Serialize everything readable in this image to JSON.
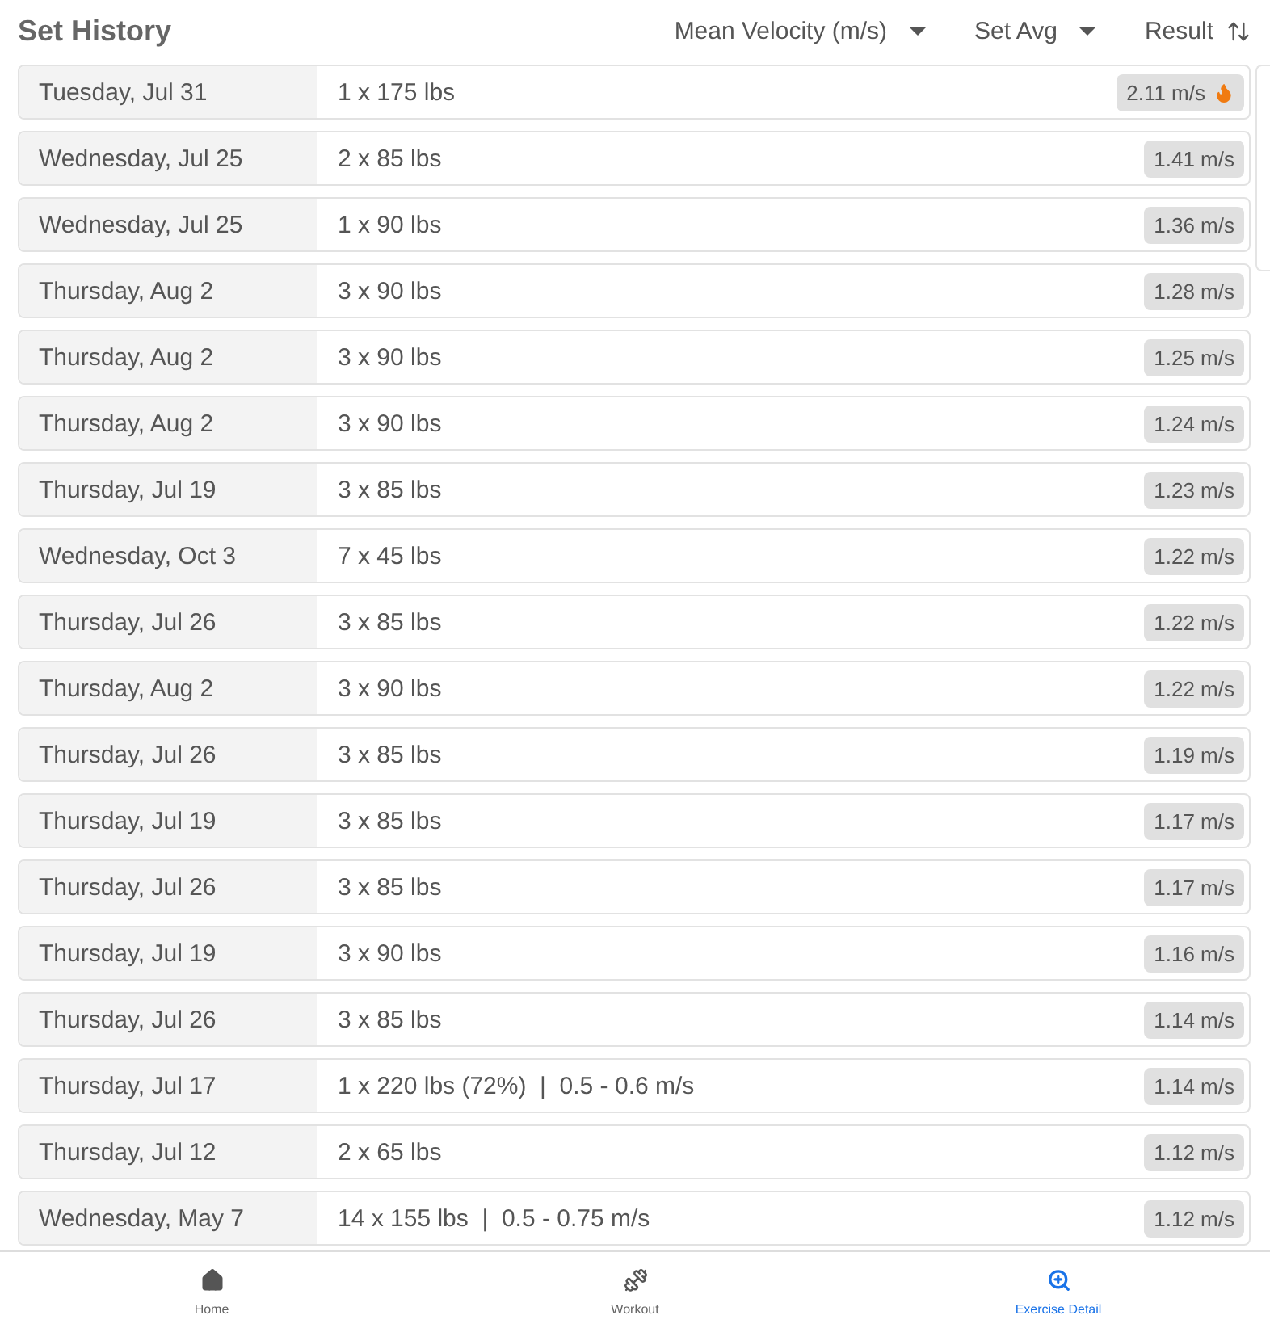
{
  "header": {
    "title": "Set History",
    "filters": [
      {
        "label": "Mean Velocity (m/s)",
        "kind": "dropdown"
      },
      {
        "label": "Set Avg",
        "kind": "dropdown"
      },
      {
        "label": "Result",
        "kind": "sort"
      }
    ]
  },
  "sets": [
    {
      "date": "Tuesday, Jul 31",
      "detail": "1 x 175 lbs",
      "result": "2.11 m/s",
      "hot": true
    },
    {
      "date": "Wednesday, Jul 25",
      "detail": "2 x 85 lbs",
      "result": "1.41 m/s",
      "hot": false
    },
    {
      "date": "Wednesday, Jul 25",
      "detail": "1 x 90 lbs",
      "result": "1.36 m/s",
      "hot": false
    },
    {
      "date": "Thursday, Aug 2",
      "detail": "3 x 90 lbs",
      "result": "1.28 m/s",
      "hot": false
    },
    {
      "date": "Thursday, Aug 2",
      "detail": "3 x 90 lbs",
      "result": "1.25 m/s",
      "hot": false
    },
    {
      "date": "Thursday, Aug 2",
      "detail": "3 x 90 lbs",
      "result": "1.24 m/s",
      "hot": false
    },
    {
      "date": "Thursday, Jul 19",
      "detail": "3 x 85 lbs",
      "result": "1.23 m/s",
      "hot": false
    },
    {
      "date": "Wednesday, Oct 3",
      "detail": "7 x 45 lbs",
      "result": "1.22 m/s",
      "hot": false
    },
    {
      "date": "Thursday, Jul 26",
      "detail": "3 x 85 lbs",
      "result": "1.22 m/s",
      "hot": false
    },
    {
      "date": "Thursday, Aug 2",
      "detail": "3 x 90 lbs",
      "result": "1.22 m/s",
      "hot": false
    },
    {
      "date": "Thursday, Jul 26",
      "detail": "3 x 85 lbs",
      "result": "1.19 m/s",
      "hot": false
    },
    {
      "date": "Thursday, Jul 19",
      "detail": "3 x 85 lbs",
      "result": "1.17 m/s",
      "hot": false
    },
    {
      "date": "Thursday, Jul 26",
      "detail": "3 x 85 lbs",
      "result": "1.17 m/s",
      "hot": false
    },
    {
      "date": "Thursday, Jul 19",
      "detail": "3 x 90 lbs",
      "result": "1.16 m/s",
      "hot": false
    },
    {
      "date": "Thursday, Jul 26",
      "detail": "3 x 85 lbs",
      "result": "1.14 m/s",
      "hot": false
    },
    {
      "date": "Thursday, Jul 17",
      "detail": "1 x 220 lbs (72%)  |  0.5 - 0.6 m/s",
      "result": "1.14 m/s",
      "hot": false
    },
    {
      "date": "Thursday, Jul 12",
      "detail": "2 x 65 lbs",
      "result": "1.12 m/s",
      "hot": false
    },
    {
      "date": "Wednesday, May 7",
      "detail": "14 x 155 lbs  |  0.5 - 0.75 m/s",
      "result": "1.12 m/s",
      "hot": false
    }
  ],
  "nav": [
    {
      "label": "Home",
      "kind": "home",
      "selected": false
    },
    {
      "label": "Workout",
      "kind": "workout",
      "selected": false
    },
    {
      "label": "Exercise Detail",
      "kind": "detail",
      "selected": true
    }
  ]
}
